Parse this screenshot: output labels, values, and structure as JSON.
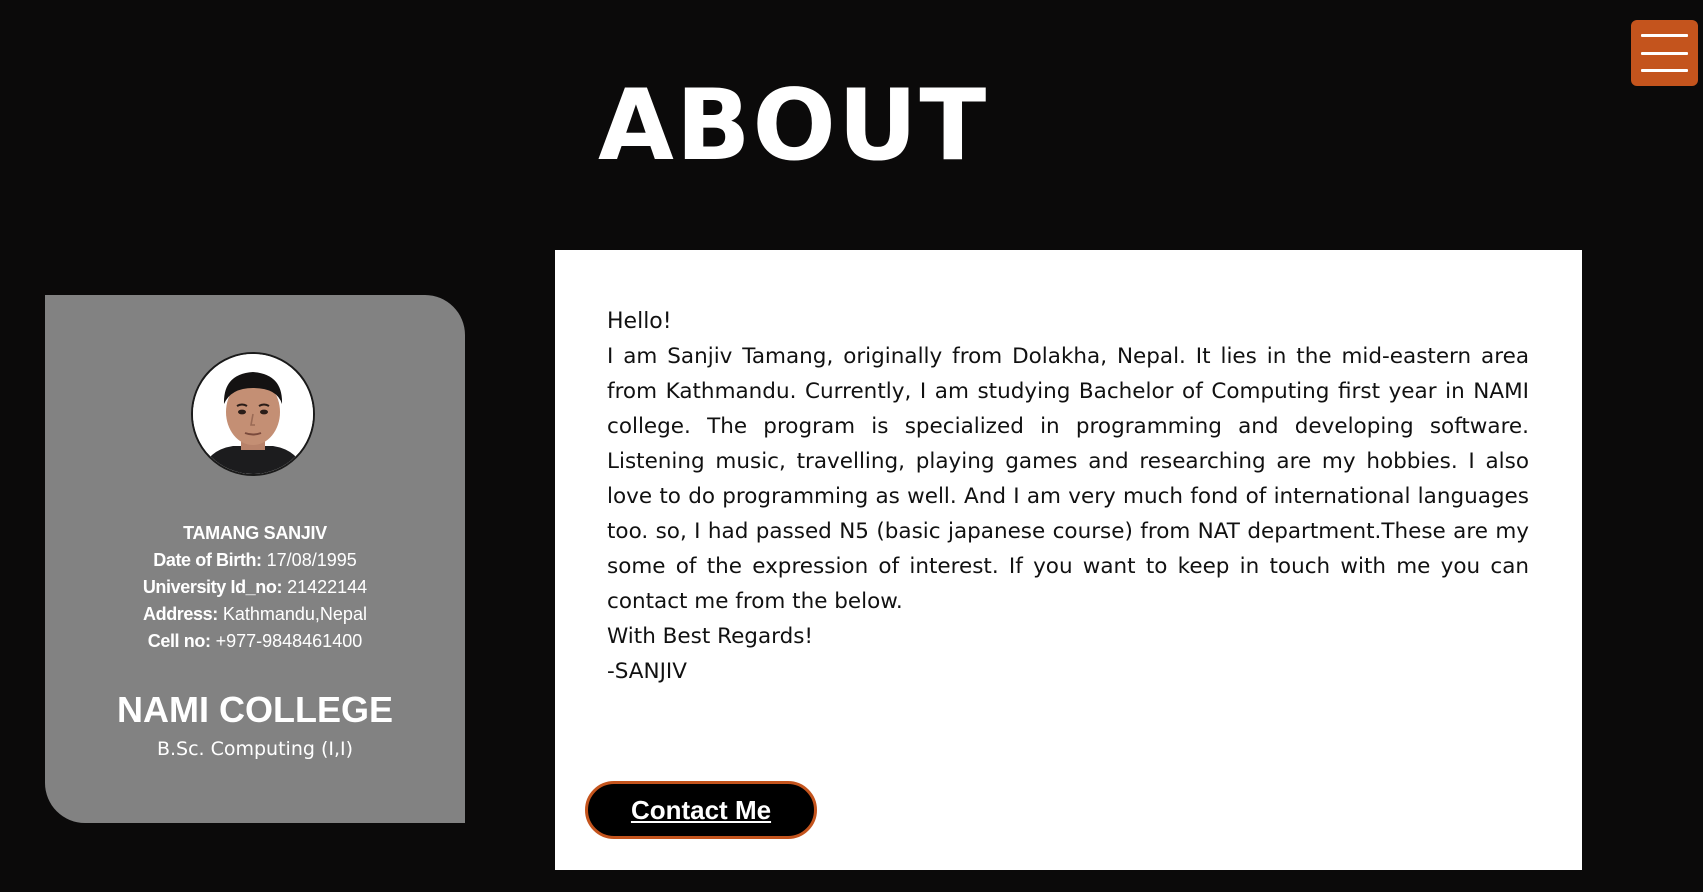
{
  "header": {
    "title": "ABOUT"
  },
  "menu": {
    "icon": "hamburger-menu-icon",
    "color": "#c4541d"
  },
  "profile": {
    "avatar_icon": "profile-photo",
    "name": "TAMANG SANJIV",
    "fields": [
      {
        "label": "Date of Birth:",
        "value": "17/08/1995"
      },
      {
        "label": "University Id_no:",
        "value": "21422144"
      },
      {
        "label": "Address:",
        "value": "Kathmandu,Nepal"
      },
      {
        "label": "Cell no:",
        "value": "+977-9848461400"
      }
    ],
    "college": "NAMI COLLEGE",
    "course": "B.Sc. Computing (I,I)"
  },
  "about": {
    "greeting": "Hello!",
    "body": "I am Sanjiv Tamang, originally from Dolakha, Nepal. It lies in the mid-eastern area from Kathmandu. Currently, I am studying Bachelor of Computing first year in NAMI college. The program is specialized in programming and developing software. Listening music, travelling, playing games and researching are my hobbies. I also love to do programming as well. And I am very much fond of international languages too. so, I had passed N5 (basic japanese course) from NAT department.These are my some of the expression of interest. If you want to keep in touch with me you can contact me from the below.",
    "regards": "With Best Regards!",
    "signature": "-SANJIV",
    "contact_label": "Contact Me"
  },
  "colors": {
    "background": "#0b0a0a",
    "card": "#828282",
    "accent": "#c4541d"
  }
}
